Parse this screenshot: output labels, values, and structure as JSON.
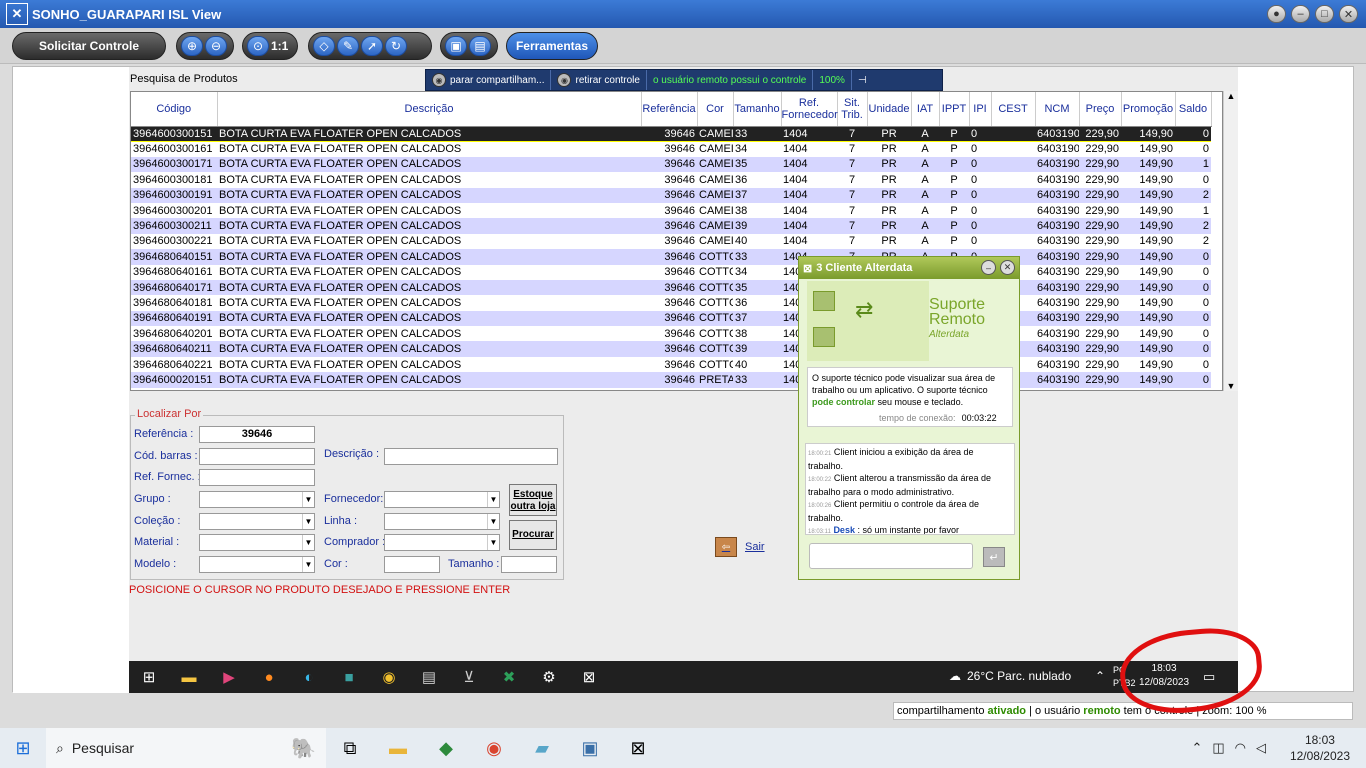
{
  "window": {
    "title": "SONHO_GUARAPARI ISL View"
  },
  "toolbar": {
    "request_control": "Solicitar Controle",
    "zoom_ratio": "1:1",
    "tools": "Ferramentas"
  },
  "banner": {
    "stop_sharing": "parar compartilham...",
    "remove_control": "retirar controle",
    "control_msg": "o usuário remoto possui o controle",
    "zoom": "100%"
  },
  "app": {
    "title": "Pesquisa de Produtos",
    "columns": [
      "Código",
      "Descrição",
      "Referência",
      "Cor",
      "Tamanho",
      "Ref. Fornecedor",
      "Sit. Trib.",
      "Unidade",
      "IAT",
      "IPPT",
      "IPI",
      "CEST",
      "NCM",
      "Preço",
      "Promoção",
      "Saldo"
    ],
    "rows": [
      [
        "3964600300151",
        "BOTA CURTA EVA FLOATER OPEN CALCADOS",
        "39646",
        "CAMEI",
        "33",
        "1404",
        "7",
        "PR",
        "A",
        "P",
        "0",
        "",
        "6403190(",
        "229,90",
        "149,90",
        "0"
      ],
      [
        "3964600300161",
        "BOTA CURTA EVA FLOATER OPEN CALCADOS",
        "39646",
        "CAMEI",
        "34",
        "1404",
        "7",
        "PR",
        "A",
        "P",
        "0",
        "",
        "6403190(",
        "229,90",
        "149,90",
        "0"
      ],
      [
        "3964600300171",
        "BOTA CURTA EVA FLOATER OPEN CALCADOS",
        "39646",
        "CAMEI",
        "35",
        "1404",
        "7",
        "PR",
        "A",
        "P",
        "0",
        "",
        "6403190(",
        "229,90",
        "149,90",
        "1"
      ],
      [
        "3964600300181",
        "BOTA CURTA EVA FLOATER OPEN CALCADOS",
        "39646",
        "CAMEI",
        "36",
        "1404",
        "7",
        "PR",
        "A",
        "P",
        "0",
        "",
        "6403190(",
        "229,90",
        "149,90",
        "0"
      ],
      [
        "3964600300191",
        "BOTA CURTA EVA FLOATER OPEN CALCADOS",
        "39646",
        "CAMEI",
        "37",
        "1404",
        "7",
        "PR",
        "A",
        "P",
        "0",
        "",
        "6403190(",
        "229,90",
        "149,90",
        "2"
      ],
      [
        "3964600300201",
        "BOTA CURTA EVA FLOATER OPEN CALCADOS",
        "39646",
        "CAMEI",
        "38",
        "1404",
        "7",
        "PR",
        "A",
        "P",
        "0",
        "",
        "6403190(",
        "229,90",
        "149,90",
        "1"
      ],
      [
        "3964600300211",
        "BOTA CURTA EVA FLOATER OPEN CALCADOS",
        "39646",
        "CAMEI",
        "39",
        "1404",
        "7",
        "PR",
        "A",
        "P",
        "0",
        "",
        "6403190(",
        "229,90",
        "149,90",
        "2"
      ],
      [
        "3964600300221",
        "BOTA CURTA EVA FLOATER OPEN CALCADOS",
        "39646",
        "CAMEI",
        "40",
        "1404",
        "7",
        "PR",
        "A",
        "P",
        "0",
        "",
        "6403190(",
        "229,90",
        "149,90",
        "2"
      ],
      [
        "3964680640151",
        "BOTA CURTA EVA FLOATER OPEN CALCADOS",
        "39646",
        "COTTC",
        "33",
        "1404",
        "7",
        "PR",
        "A",
        "P",
        "0",
        "",
        "6403190(",
        "229,90",
        "149,90",
        "0"
      ],
      [
        "3964680640161",
        "BOTA CURTA EVA FLOATER OPEN CALCADOS",
        "39646",
        "COTTC",
        "34",
        "140",
        "",
        "",
        "",
        "",
        "",
        "",
        "6403190(",
        "229,90",
        "149,90",
        "0"
      ],
      [
        "3964680640171",
        "BOTA CURTA EVA FLOATER OPEN CALCADOS",
        "39646",
        "COTTC",
        "35",
        "140",
        "",
        "",
        "",
        "",
        "",
        "",
        "6403190(",
        "229,90",
        "149,90",
        "0"
      ],
      [
        "3964680640181",
        "BOTA CURTA EVA FLOATER OPEN CALCADOS",
        "39646",
        "COTTC",
        "36",
        "140",
        "",
        "",
        "",
        "",
        "",
        "",
        "6403190(",
        "229,90",
        "149,90",
        "0"
      ],
      [
        "3964680640191",
        "BOTA CURTA EVA FLOATER OPEN CALCADOS",
        "39646",
        "COTTC",
        "37",
        "140",
        "",
        "",
        "",
        "",
        "",
        "",
        "6403190(",
        "229,90",
        "149,90",
        "0"
      ],
      [
        "3964680640201",
        "BOTA CURTA EVA FLOATER OPEN CALCADOS",
        "39646",
        "COTTC",
        "38",
        "140",
        "",
        "",
        "",
        "",
        "",
        "",
        "6403190(",
        "229,90",
        "149,90",
        "0"
      ],
      [
        "3964680640211",
        "BOTA CURTA EVA FLOATER OPEN CALCADOS",
        "39646",
        "COTTC",
        "39",
        "140",
        "",
        "",
        "",
        "",
        "",
        "",
        "6403190(",
        "229,90",
        "149,90",
        "0"
      ],
      [
        "3964680640221",
        "BOTA CURTA EVA FLOATER OPEN CALCADOS",
        "39646",
        "COTTC",
        "40",
        "140",
        "",
        "",
        "",
        "",
        "",
        "",
        "6403190(",
        "229,90",
        "149,90",
        "0"
      ],
      [
        "3964600020151",
        "BOTA CURTA EVA FLOATER OPEN CALCADOS",
        "39646",
        "PRETA",
        "33",
        "140",
        "",
        "",
        "",
        "",
        "",
        "",
        "6403190(",
        "229,90",
        "149,90",
        "0"
      ]
    ],
    "find": {
      "legend": "Localizar Por",
      "referencia_label": "Referência :",
      "referencia_value": "39646",
      "cod_barras_label": "Cód. barras :",
      "ref_fornec_label": "Ref. Fornec. :",
      "descricao_label": "Descrição :",
      "grupo_label": "Grupo :",
      "fornecedor_label": "Fornecedor:",
      "colecao_label": "Coleção :",
      "linha_label": "Linha :",
      "material_label": "Material :",
      "comprador_label": "Comprador :",
      "modelo_label": "Modelo :",
      "cor_label": "Cor :",
      "tamanho_label": "Tamanho :",
      "estoque_btn": "Estoque outra loja",
      "procurar_btn": "Procurar"
    },
    "hint": "POSICIONE O CURSOR NO PRODUTO DESEJADO E PRESSIONE ENTER",
    "sair": "Sair"
  },
  "remote_taskbar": {
    "weather": "26°C  Parc. nublado",
    "lang": "PO\nPTB2",
    "time": "18:03",
    "date": "12/08/2023"
  },
  "popup": {
    "title": "3 Cliente Alterdata",
    "brand_line1": "Suporte",
    "brand_line2": "Remoto",
    "brand_sub": "Alterdata",
    "msg_plain1": "O suporte técnico pode visualizar sua área de trabalho ou um aplicativo. O suporte técnico ",
    "msg_bold": "pode controlar",
    "msg_plain2": " seu mouse e teclado.",
    "conn_label": "tempo de conexão:",
    "conn_time": "00:03:22",
    "chat": [
      {
        "ts": "18:00:21",
        "text": "Client iniciou a exibição da área de trabalho."
      },
      {
        "ts": "18:00:22",
        "text": "Client alterou a transmissão da área de trabalho para o modo administrativo."
      },
      {
        "ts": "18:00:26",
        "text": "Client permitiu o controle da área de trabalho."
      }
    ],
    "chat_last_ts": "18:03:11",
    "chat_last_name": "Desk",
    "chat_last_text": ": só um instante por favor"
  },
  "status": {
    "p1": "compartilhamento ",
    "p2": "ativado",
    "p3": "  |  o usuário ",
    "p4": "remoto",
    "p5": " tem o controle  |  zoom: 100 %"
  },
  "local_taskbar": {
    "search": "Pesquisar",
    "time": "18:03",
    "date": "12/08/2023"
  }
}
